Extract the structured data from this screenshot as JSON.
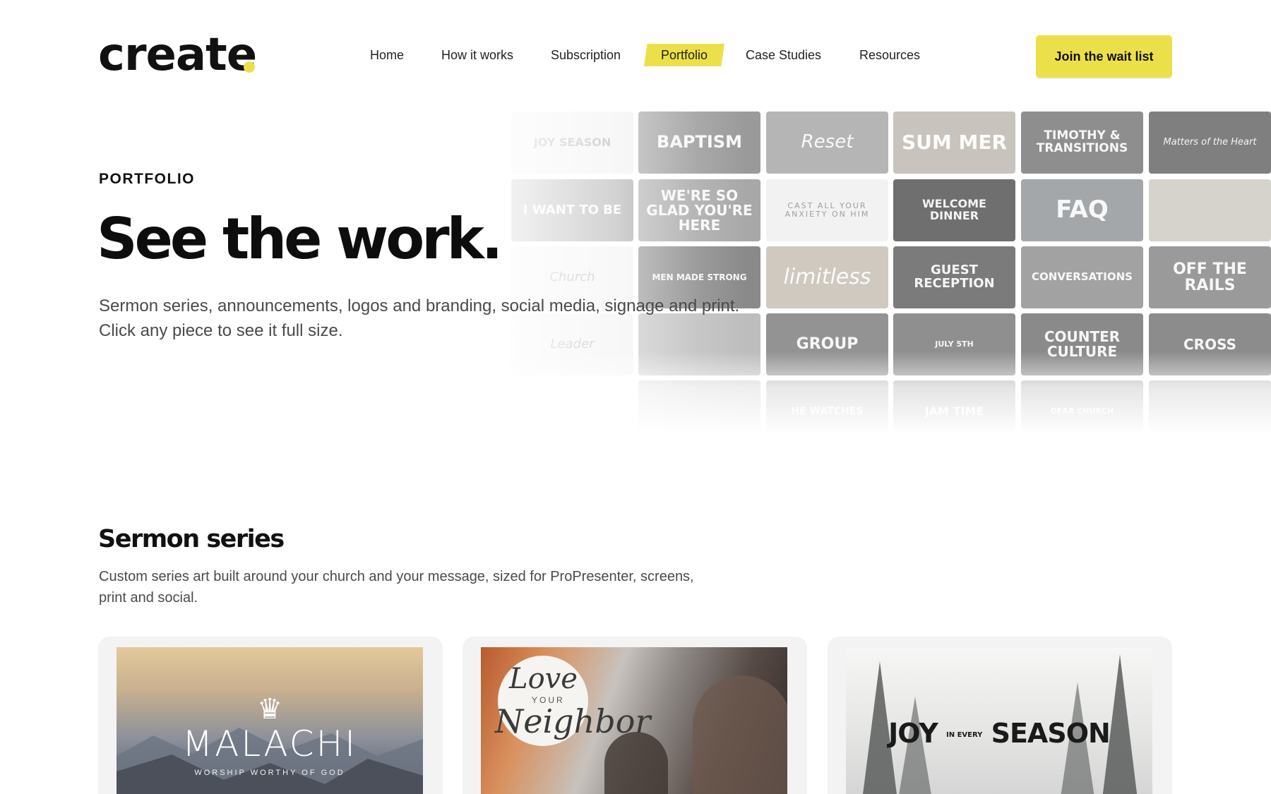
{
  "brand": {
    "logo_text": "create",
    "accent": "#ece04a"
  },
  "nav": {
    "items": [
      {
        "label": "Home",
        "active": false
      },
      {
        "label": "How it works",
        "active": false
      },
      {
        "label": "Subscription",
        "active": false
      },
      {
        "label": "Portfolio",
        "active": true
      },
      {
        "label": "Case Studies",
        "active": false
      },
      {
        "label": "Resources",
        "active": false
      }
    ],
    "cta_label": "Join the wait list"
  },
  "hero": {
    "eyebrow": "PORTFOLIO",
    "title": "See the work.",
    "subtitle": "Sermon series, announcements, logos and branding, social media, signage and print. Click any piece to see it full size."
  },
  "mosaic": {
    "tiles": [
      {
        "text": "JOY SEASON"
      },
      {
        "text": "BAPTISM"
      },
      {
        "text": "Reset"
      },
      {
        "text": "SUM MER"
      },
      {
        "text": "TIMOTHY & TRANSITIONS"
      },
      {
        "text": "Matters of the Heart"
      },
      {
        "text": "I WANT TO BE"
      },
      {
        "text": "WE'RE SO GLAD YOU'RE HERE"
      },
      {
        "text": "CAST ALL YOUR ANXIETY ON HIM"
      },
      {
        "text": "WELCOME DINNER"
      },
      {
        "text": "FAQ"
      },
      {
        "text": ""
      },
      {
        "text": "Church"
      },
      {
        "text": "MEN MADE STRONG"
      },
      {
        "text": "limitless"
      },
      {
        "text": "GUEST RECEPTION"
      },
      {
        "text": "CONVERSATIONS"
      },
      {
        "text": "OFF THE RAILS"
      },
      {
        "text": "Leader"
      },
      {
        "text": ""
      },
      {
        "text": "GROUP"
      },
      {
        "text": "JULY 5TH"
      },
      {
        "text": "COUNTER CULTURE"
      },
      {
        "text": "CROSS"
      },
      {
        "text": ""
      },
      {
        "text": "HE WATCHES"
      },
      {
        "text": "JAM TIME"
      },
      {
        "text": "DEAR CHURCH"
      },
      {
        "text": ""
      }
    ]
  },
  "sermon_section": {
    "title": "Sermon series",
    "subtitle": "Custom series art built around your church and your message, sized for ProPresenter, screens, print and social.",
    "cards": [
      {
        "title": "MALACHI",
        "tagline": "WORSHIP WORTHY OF GOD"
      },
      {
        "title_top": "Love",
        "title_mid": "YOUR",
        "title_bottom": "Neighbor"
      },
      {
        "title_left": "JOY",
        "title_small": "IN EVERY",
        "title_right": "SEASON"
      }
    ]
  }
}
